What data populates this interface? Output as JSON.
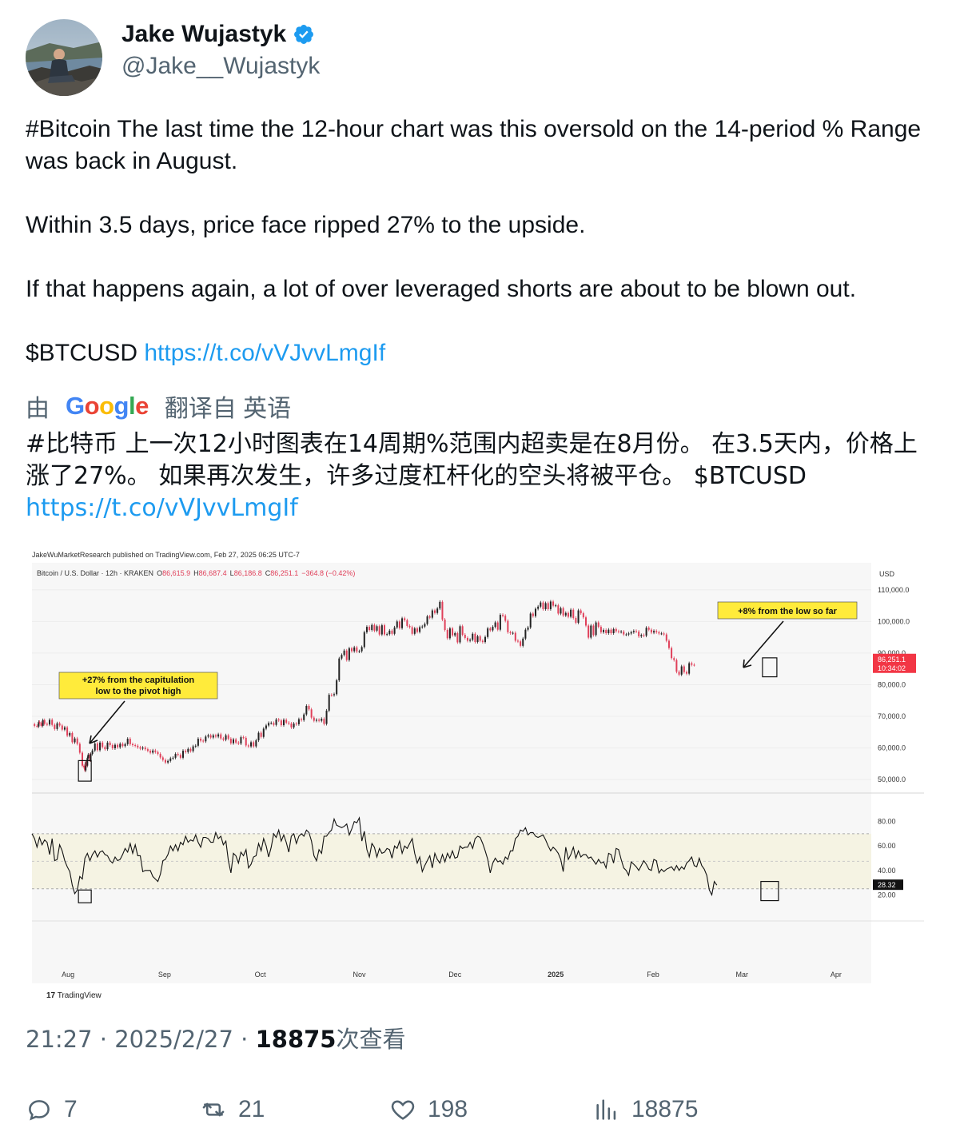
{
  "author": {
    "name": "Jake Wujastyk",
    "handle": "@Jake__Wujastyk"
  },
  "tweet": {
    "line1": "#Bitcoin The last time the 12-hour chart was this oversold on the 14-period % Range was back in August.",
    "line2": "Within 3.5 days, price face ripped 27% to the upside.",
    "line3": "If that happens again, a lot of over leveraged shorts are about to be blown out.",
    "ticker": "$BTCUSD",
    "link": "https://t.co/vVJvvLmgIf"
  },
  "translation": {
    "by": "由",
    "google": "Google",
    "label": "翻译自 英语",
    "text": "#比特币 上一次12小时图表在14周期%范围内超卖是在8月份。 在3.5天内，价格上涨了27%。 如果再次发生，许多过度杠杆化的空头将被平仓。 $BTCUSD",
    "link": "https://t.co/vVJvvLmgIf"
  },
  "chart_data": {
    "type": "line",
    "published": "JakeWuMarketResearch published on TradingView.com, Feb 27, 2025 06:25 UTC-7",
    "symbol": "Bitcoin / U.S. Dollar · 12h · KRAKEN",
    "ohlc": {
      "o_label": "O",
      "o": "86,615.9",
      "h_label": "H",
      "h": "86,687.4",
      "l_label": "L",
      "l": "86,186.8",
      "c_label": "C",
      "c": "86,251.1",
      "chg": "−364.8 (−0.42%)"
    },
    "currency": "USD",
    "price_ticks": [
      "110,000.0",
      "100,000.0",
      "90,000.0",
      "80,000.0",
      "70,000.0",
      "60,000.0",
      "50,000.0"
    ],
    "price_tick_values": [
      110000,
      100000,
      90000,
      80000,
      70000,
      60000,
      50000
    ],
    "price_ylim": [
      47000,
      114000
    ],
    "last_price": "86,251.1",
    "countdown": "10:34:02",
    "osc_ticks": [
      "80.00",
      "60.00",
      "40.00",
      "20.00"
    ],
    "osc_tick_values": [
      80,
      60,
      40,
      20
    ],
    "osc_ylim": [
      0,
      100
    ],
    "osc_last": "28.32",
    "osc_band": [
      25,
      70
    ],
    "x_ticks": [
      "Aug",
      "Sep",
      "Oct",
      "Nov",
      "Dec",
      "2025",
      "Feb",
      "Mar",
      "Apr"
    ],
    "annotation_left": [
      "+27% from the capitulation",
      "low to the pivot high"
    ],
    "annotation_right": "+8% from the low so far",
    "price_series": {
      "name": "",
      "x": [
        0,
        3,
        6,
        8,
        9,
        11,
        13,
        15,
        18,
        21,
        24,
        27,
        30,
        33,
        36,
        39,
        42,
        45,
        48,
        51,
        54,
        57,
        60,
        62,
        63,
        64,
        65,
        66,
        67,
        69,
        70,
        72,
        75,
        78,
        81,
        84,
        87,
        90,
        93,
        96,
        99,
        102,
        105,
        108,
        111,
        114,
        117,
        120,
        123,
        126,
        129,
        132,
        135,
        138,
        141,
        144,
        147,
        150,
        153,
        156,
        159,
        162,
        165,
        168,
        171,
        174,
        177,
        180,
        183,
        186,
        189,
        192,
        195,
        198,
        201,
        204,
        207,
        210,
        213,
        216,
        219,
        222,
        225,
        228,
        231,
        234,
        237,
        240,
        243,
        246,
        249,
        252,
        255,
        258,
        261,
        264,
        267,
        270,
        273,
        276,
        279,
        282,
        285,
        288,
        291,
        294,
        297,
        300,
        303,
        306,
        309,
        312,
        315,
        318,
        321,
        324,
        327,
        330,
        333,
        336,
        339,
        342,
        345,
        348,
        351,
        354,
        357,
        360,
        363,
        366,
        369,
        372,
        375,
        378,
        381,
        384,
        387,
        390,
        393,
        396,
        399,
        402,
        405,
        408,
        411,
        414,
        417,
        420,
        423,
        426,
        429,
        432,
        435,
        438,
        441,
        444,
        447,
        450,
        453,
        456,
        459,
        462,
        465,
        468,
        471,
        474,
        477,
        480,
        483,
        486,
        489,
        492,
        495,
        498,
        501,
        504,
        507,
        510,
        513,
        516,
        519,
        522,
        525,
        528,
        531,
        534,
        537,
        540,
        543,
        546,
        549,
        552,
        555,
        558,
        561,
        564,
        567,
        570,
        573,
        576,
        579,
        582,
        585,
        588,
        591,
        594,
        597,
        600,
        603,
        606,
        609,
        612,
        615,
        618,
        621,
        624,
        627,
        630,
        633,
        636,
        639,
        642,
        645,
        648,
        651,
        654,
        657,
        660,
        663,
        666,
        669,
        672,
        675,
        678,
        681,
        684,
        687,
        690,
        693,
        696,
        699,
        702,
        705,
        708,
        711,
        714,
        717,
        720,
        723,
        726,
        729,
        732,
        735,
        738,
        741,
        744,
        747,
        750,
        753,
        756,
        759,
        762,
        765,
        768,
        771,
        774,
        777,
        780,
        783,
        786,
        789,
        792,
        795,
        798,
        801,
        804,
        807,
        810,
        813,
        816,
        819,
        822,
        825,
        828,
        831,
        834,
        837,
        840,
        843,
        846,
        849,
        852,
        855,
        858,
        861,
        864,
        867,
        870,
        871,
        872,
        873,
        874,
        875,
        876,
        877,
        878
      ],
      "values": [
        67500,
        67000,
        66800,
        68200,
        67900,
        67000,
        68800,
        67600,
        67400,
        68900,
        67300,
        66000,
        67800,
        67100,
        65800,
        66500,
        63900,
        64700,
        61800,
        63000,
        61300,
        58500,
        54400,
        53900,
        52900,
        55500,
        54400,
        56800,
        57900,
        56100,
        58100,
        59200,
        61400,
        59300,
        61700,
        60300,
        59600,
        61700,
        60900,
        59900,
        61000,
        60200,
        61300,
        60600,
        61200,
        62900,
        61200,
        60900,
        60700,
        60200,
        59800,
        60100,
        59600,
        59100,
        58500,
        59200,
        58700,
        58100,
        57000,
        56200,
        55400,
        55900,
        56700,
        56900,
        58100,
        57800,
        56900,
        59100,
        58700,
        59700,
        59000,
        60500,
        60700,
        62900,
        62300,
        62100,
        63600,
        64000,
        63300,
        64000,
        63600,
        64300,
        63000,
        62600,
        64000,
        62900,
        61500,
        62700,
        61700,
        61400,
        63400,
        63200,
        60800,
        60500,
        61800,
        60500,
        62400,
        64800,
        63500,
        66100,
        67100,
        67900,
        67900,
        67300,
        69000,
        68700,
        67200,
        68900,
        68000,
        67700,
        66500,
        67700,
        67500,
        69100,
        68800,
        70600,
        73300,
        72200,
        69600,
        68600,
        68900,
        68600,
        69200,
        67600,
        71800,
        76800,
        76700,
        77000,
        81400,
        88300,
        89400,
        90800,
        87800,
        91500,
        90600,
        91800,
        90500,
        90600,
        91900,
        96600,
        98300,
        97300,
        98900,
        97100,
        98500,
        95900,
        98800,
        95900,
        96000,
        97100,
        96100,
        98100,
        100000,
        97900,
        101000,
        100400,
        98600,
        98200,
        96100,
        97800,
        96700,
        98200,
        98400,
        99200,
        101600,
        101200,
        103500,
        102700,
        104100,
        106200,
        100600,
        97300,
        94700,
        97800,
        95600,
        96300,
        93400,
        98500,
        95800,
        94800,
        93900,
        94200,
        96100,
        93500,
        95300,
        93900,
        93500,
        95100,
        97800,
        97200,
        98300,
        99700,
        97400,
        102100,
        101800,
        100200,
        96600,
        96300,
        96400,
        93900,
        93700,
        92300,
        94600,
        97400,
        98100,
        102500,
        101700,
        104000,
        104700,
        106000,
        103900,
        105800,
        103900,
        106300,
        105000,
        105100,
        102500,
        104200,
        101900,
        102700,
        101500,
        103700,
        101100,
        99600,
        103500,
        102600,
        101300,
        98700,
        94900,
        98700,
        95700,
        99700,
        98300,
        96600,
        97300,
        96300,
        97400,
        96300,
        97600,
        96900,
        96700,
        96800,
        95900,
        95900,
        96200,
        96600,
        97000,
        96800,
        95300,
        95700,
        95500,
        98000,
        97400,
        96500,
        97000,
        96600,
        96200,
        96200,
        95900,
        93900,
        91600,
        88400,
        87800,
        84100,
        83200,
        85800,
        84000,
        83500,
        86800,
        86300,
        86251
      ]
    },
    "osc_series": {
      "name": "",
      "x": [
        0,
        3,
        6,
        9,
        12,
        15,
        18,
        21,
        24,
        27,
        30,
        33,
        36,
        39,
        42,
        45,
        48,
        51,
        54,
        57,
        60,
        63,
        66,
        69,
        72,
        75,
        78,
        81,
        84,
        87,
        90,
        93,
        96,
        99,
        102,
        105,
        108,
        111,
        114,
        117,
        120,
        123,
        126,
        129,
        132,
        135,
        138,
        141,
        144,
        147,
        150,
        153,
        156,
        159,
        162,
        165,
        168,
        171,
        174,
        177,
        180,
        183,
        186,
        189,
        192,
        195,
        198,
        201,
        204,
        207,
        210,
        213,
        216,
        219,
        222,
        225,
        228,
        231,
        234,
        237,
        240,
        243,
        246,
        249,
        252,
        255,
        258,
        261,
        264,
        267,
        270,
        273,
        276,
        279,
        282,
        285,
        288,
        291,
        294,
        297,
        300,
        303,
        306,
        309,
        312,
        315,
        318,
        321,
        324,
        327,
        330,
        333,
        336,
        339,
        342,
        345,
        348,
        351,
        354,
        357,
        360,
        363,
        366,
        369,
        372,
        375,
        378,
        381,
        384,
        387,
        390,
        393,
        396,
        399,
        402,
        405,
        408,
        411,
        414,
        417,
        420,
        423,
        426,
        429,
        432,
        435,
        438,
        441,
        444,
        447,
        450,
        453,
        456,
        459,
        462,
        465,
        468,
        471,
        474,
        477,
        480,
        483,
        486,
        489,
        492,
        495,
        498,
        501,
        504,
        507,
        510,
        513,
        516,
        519,
        522,
        525,
        528,
        531,
        534,
        537,
        540,
        543,
        546,
        549,
        552,
        555,
        558,
        561,
        564,
        567,
        570,
        573,
        576,
        579,
        582,
        585,
        588,
        591,
        594,
        597,
        600,
        603,
        606,
        609,
        612,
        615,
        618,
        621,
        624,
        627,
        630,
        633,
        636,
        639,
        642,
        645,
        648,
        651,
        654,
        657,
        660,
        663,
        666,
        669,
        672,
        675,
        678,
        681,
        684,
        687,
        690,
        693,
        696,
        699,
        702,
        705,
        708,
        711,
        714,
        717,
        720,
        723,
        726,
        729,
        732,
        735,
        738,
        741,
        744,
        747,
        750,
        753,
        756,
        759,
        762,
        765,
        768,
        771,
        774,
        777,
        780,
        783,
        786,
        789,
        792,
        795,
        798,
        801,
        804,
        807,
        810,
        813,
        816,
        819,
        822,
        825,
        828,
        831,
        834,
        837,
        840,
        843,
        846,
        849,
        852,
        855,
        858,
        861,
        864,
        867,
        870,
        873,
        876,
        878
      ],
      "values": [
        70,
        66,
        59,
        67,
        61,
        65,
        63,
        53,
        66,
        48,
        49,
        61,
        56,
        48,
        43,
        39,
        28,
        21,
        24,
        35,
        33,
        50,
        54,
        48,
        53,
        56,
        51,
        55,
        56,
        53,
        52,
        48,
        46,
        51,
        48,
        49,
        53,
        58,
        55,
        62,
        54,
        61,
        52,
        52,
        39,
        40,
        40,
        40,
        35,
        33,
        31,
        37,
        48,
        49,
        53,
        60,
        56,
        61,
        56,
        63,
        61,
        68,
        63,
        65,
        64,
        69,
        63,
        59,
        67,
        67,
        66,
        63,
        63,
        71,
        66,
        68,
        61,
        64,
        48,
        38,
        54,
        52,
        46,
        55,
        52,
        57,
        42,
        45,
        51,
        52,
        62,
        56,
        66,
        60,
        51,
        59,
        70,
        67,
        73,
        64,
        69,
        63,
        55,
        68,
        70,
        62,
        68,
        70,
        68,
        73,
        71,
        64,
        52,
        48,
        57,
        54,
        68,
        68,
        71,
        73,
        82,
        77,
        76,
        75,
        76,
        78,
        69,
        74,
        80,
        79,
        83,
        64,
        72,
        57,
        51,
        62,
        59,
        51,
        58,
        54,
        55,
        58,
        57,
        50,
        60,
        58,
        64,
        54,
        60,
        58,
        62,
        66,
        54,
        46,
        51,
        39,
        44,
        48,
        52,
        42,
        54,
        49,
        46,
        53,
        47,
        54,
        50,
        56,
        50,
        51,
        60,
        58,
        59,
        59,
        63,
        58,
        66,
        68,
        67,
        62,
        56,
        49,
        38,
        46,
        50,
        47,
        48,
        45,
        51,
        49,
        56,
        56,
        66,
        68,
        73,
        72,
        75,
        69,
        71,
        71,
        68,
        67,
        68,
        69,
        65,
        60,
        56,
        59,
        57,
        54,
        49,
        39,
        59,
        49,
        53,
        59,
        50,
        56,
        51,
        53,
        53,
        50,
        51,
        48,
        45,
        49,
        46,
        47,
        42,
        54,
        53,
        46,
        58,
        57,
        49,
        42,
        40,
        36,
        47,
        45,
        43,
        40,
        44,
        48,
        45,
        41,
        40,
        49,
        48,
        38,
        41,
        39,
        41,
        42,
        43,
        40,
        44,
        40,
        43,
        41,
        46,
        48,
        51,
        44,
        43,
        50,
        44,
        41,
        36,
        24,
        20,
        31,
        28
      ]
    }
  },
  "chart_footer": "TradingView",
  "meta": {
    "time": "21:27 · 2025/2/27 · ",
    "views": "18875",
    "views_label": "次查看"
  },
  "actions": {
    "replies": "7",
    "retweets": "21",
    "likes": "198",
    "views": "18875"
  },
  "colors": {
    "link": "#1d9bf0",
    "verified": "#1d9bf0",
    "muted": "#536471",
    "bull": "#222222",
    "bear": "#e0405a",
    "annotation": "#ffeb3b"
  }
}
